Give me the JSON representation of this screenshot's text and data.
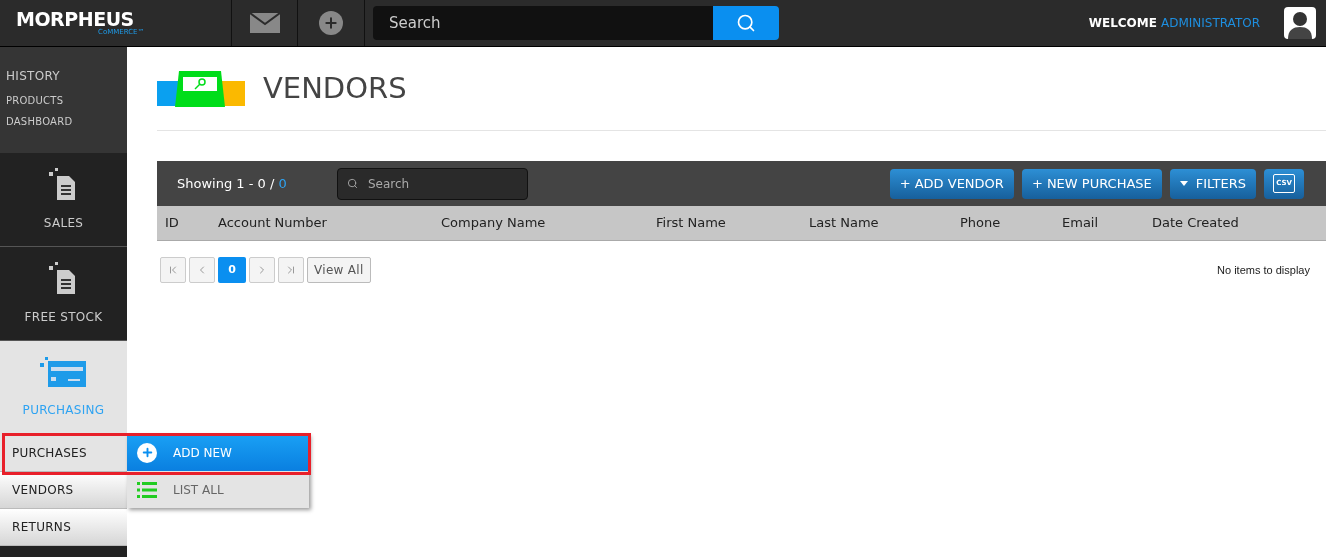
{
  "header": {
    "logo": {
      "name": "MORPHEUS",
      "tagline": "CoMMERCE™"
    },
    "search": {
      "placeholder": "Search"
    },
    "welcome": "WELCOME",
    "user": "ADMINISTRATOR"
  },
  "sidebar": {
    "links": [
      "HISTORY",
      "PRODUCTS",
      "DASHBOARD"
    ],
    "items": [
      {
        "label": "SALES",
        "kind": "document",
        "selected": false
      },
      {
        "label": "FREE STOCK",
        "kind": "document",
        "selected": false
      },
      {
        "label": "PURCHASING",
        "kind": "card",
        "selected": true
      }
    ],
    "submenu": [
      {
        "label": "PURCHASES",
        "expanded": true
      },
      {
        "label": "VENDORS",
        "expanded": false
      },
      {
        "label": "RETURNS",
        "expanded": false
      }
    ],
    "flyout": [
      {
        "label": "ADD NEW",
        "kind": "add",
        "selected": true
      },
      {
        "label": "LIST ALL",
        "kind": "list",
        "selected": false
      }
    ]
  },
  "page": {
    "title": "VENDORS"
  },
  "toolbar": {
    "showing": "Showing 1 - 0 / ",
    "total": "0",
    "search": {
      "placeholder": "Search"
    },
    "buttons": [
      {
        "label": "+ ADD VENDOR",
        "kind": "text"
      },
      {
        "label": "+ NEW PURCHASE",
        "kind": "text"
      },
      {
        "label": "FILTERS",
        "kind": "filter"
      },
      {
        "label": "CSV",
        "kind": "csv"
      }
    ]
  },
  "table": {
    "columns": [
      "ID",
      "Account Number",
      "Company Name",
      "First Name",
      "Last Name",
      "Phone",
      "Email",
      "Date Created"
    ],
    "empty": "No items to display"
  },
  "pager": {
    "pages": [
      {
        "label": "0",
        "selected": true
      }
    ],
    "view_all": "View All"
  }
}
